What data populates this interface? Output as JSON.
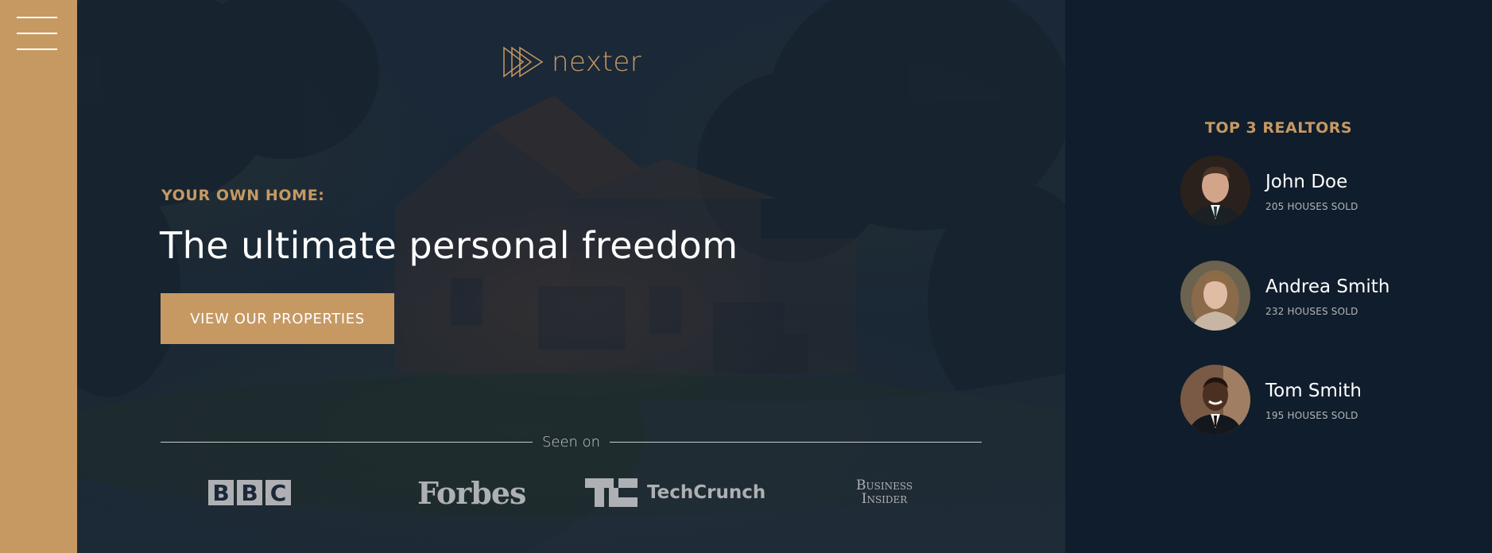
{
  "sidebar": {
    "menu_icon": "hamburger-menu-icon"
  },
  "header": {
    "logo": {
      "icon": "triple-play-triangles-icon",
      "text": "nexter"
    },
    "sub_heading": "Your own home:",
    "title": "The ultimate personal freedom",
    "cta_label": "View our properties",
    "seen_on": "Seen on",
    "press": [
      {
        "name": "BBC",
        "letters": [
          "B",
          "B",
          "C"
        ]
      },
      {
        "name": "Forbes"
      },
      {
        "name": "TechCrunch"
      },
      {
        "name": "Business Insider",
        "line1": "Business",
        "line2": "Insider"
      }
    ]
  },
  "realtors": {
    "heading": "Top 3 Realtors",
    "items": [
      {
        "name": "John Doe",
        "sold": "205 houses sold"
      },
      {
        "name": "Andrea Smith",
        "sold": "232 houses sold"
      },
      {
        "name": "Tom Smith",
        "sold": "195 houses sold"
      }
    ]
  },
  "colors": {
    "primary": "#c69963",
    "dark": "#101d2c",
    "white": "#ffffff",
    "grey": "#aeb0b4"
  }
}
